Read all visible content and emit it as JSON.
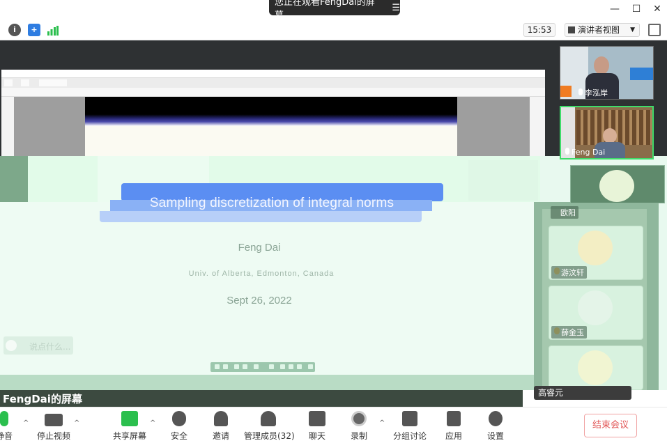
{
  "window": {
    "share_banner": "您正在观看FengDai的屏幕",
    "minimize": "—",
    "maximize": "☐",
    "close": "✕"
  },
  "meeting_toolbar": {
    "info_icon": "info-icon",
    "security_icon": "shield-icon",
    "signal_icon": "signal-icon",
    "clock": "15:53",
    "view_label": "演讲者视图"
  },
  "slide": {
    "title": "Sampling discretization of integral norms",
    "author": "Feng Dai",
    "affiliation": "Univ. of Alberta, Edmonton, Canada",
    "date": "Sept 26, 2022"
  },
  "chat": {
    "placeholder": "说点什么..."
  },
  "participants": [
    {
      "name": "李泓岸"
    },
    {
      "name": "Feng Dai"
    },
    {
      "name": "欧阳"
    },
    {
      "name": "游汶轩"
    },
    {
      "name": "薛金玉"
    },
    {
      "name": "高睿元"
    }
  ],
  "screen_owner": "FengDai的屏幕",
  "controls": [
    {
      "label": "静音",
      "icon": "mic-icon"
    },
    {
      "label": "停止视频",
      "icon": "video-icon"
    },
    {
      "label": "共享屏幕",
      "icon": "share-screen-icon"
    },
    {
      "label": "安全",
      "icon": "shield-icon"
    },
    {
      "label": "邀请",
      "icon": "invite-icon"
    },
    {
      "label": "管理成员(32)",
      "icon": "members-icon"
    },
    {
      "label": "聊天",
      "icon": "chat-icon"
    },
    {
      "label": "录制",
      "icon": "record-icon"
    },
    {
      "label": "分组讨论",
      "icon": "breakout-icon"
    },
    {
      "label": "应用",
      "icon": "apps-icon"
    },
    {
      "label": "设置",
      "icon": "gear-icon"
    }
  ],
  "end_meeting": "结束会议",
  "colors": {
    "accent_green": "#3fdc6a",
    "end_red": "#e15454",
    "slide_title_blue": "#5b8ef2"
  }
}
